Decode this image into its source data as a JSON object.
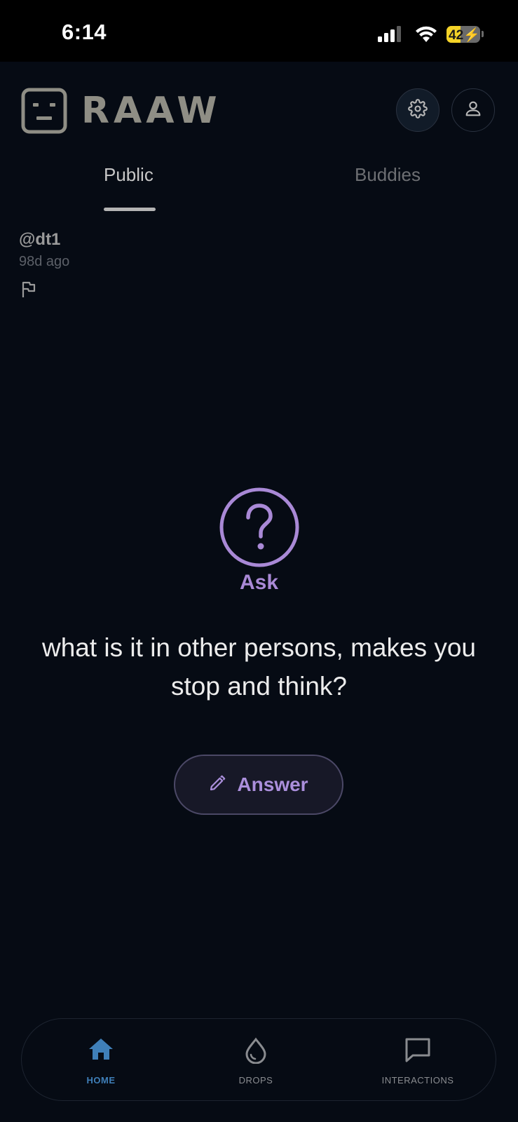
{
  "status_bar": {
    "time": "6:14",
    "battery_level": "42",
    "battery_color": "#f5d327"
  },
  "header": {
    "app_name": "RAAW",
    "settings_icon": "gear-icon",
    "profile_icon": "person-icon"
  },
  "tabs": [
    {
      "label": "Public",
      "active": true
    },
    {
      "label": "Buddies",
      "active": false
    }
  ],
  "post": {
    "username": "@dt1",
    "age": "98d ago",
    "report_icon": "flag-icon"
  },
  "prompt": {
    "icon": "question-circle-icon",
    "type_label": "Ask",
    "text": "what is it in other persons, makes you stop and think?",
    "answer_button": "Answer",
    "accent_color": "#a989d6"
  },
  "bottom_nav": [
    {
      "label": "HOME",
      "icon": "home-icon",
      "active": true
    },
    {
      "label": "DROPS",
      "icon": "drop-icon",
      "active": false
    },
    {
      "label": "INTERACTIONS",
      "icon": "chat-bubble-icon",
      "active": false
    }
  ]
}
